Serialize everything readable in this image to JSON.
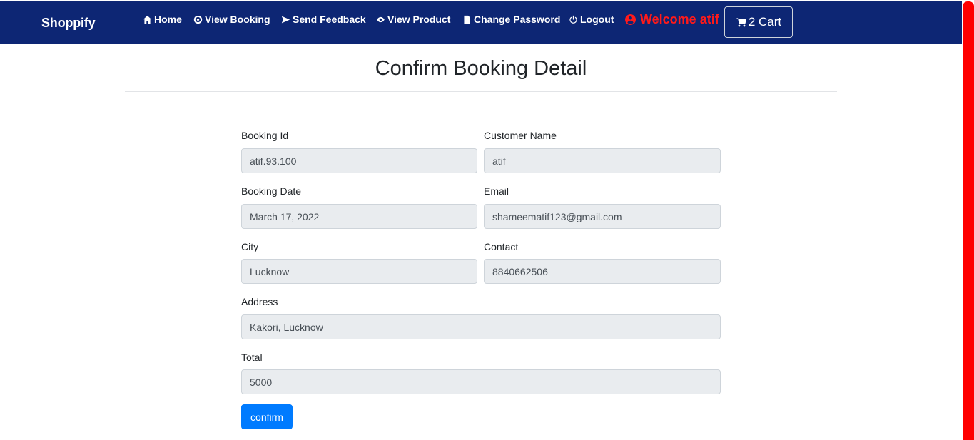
{
  "navbar": {
    "brand": "Shoppify",
    "items": [
      {
        "label": "Home",
        "icon": "home-icon"
      },
      {
        "label": "View Booking",
        "icon": "dashboard-icon"
      },
      {
        "label": "Send Feedback",
        "icon": "send-icon"
      },
      {
        "label": "View Product",
        "icon": "eye-icon"
      },
      {
        "label": "Change Password",
        "icon": "document-icon"
      },
      {
        "label": "Logout",
        "icon": "power-icon"
      }
    ],
    "welcome": "Welcome atif",
    "cart_label": "2 Cart"
  },
  "page": {
    "title": "Confirm Booking Detail"
  },
  "form": {
    "booking_id": {
      "label": "Booking Id",
      "value": "atif.93.100"
    },
    "customer_name": {
      "label": "Customer Name",
      "value": "atif"
    },
    "booking_date": {
      "label": "Booking Date",
      "value": "March 17, 2022"
    },
    "email": {
      "label": "Email",
      "value": "shameematif123@gmail.com"
    },
    "city": {
      "label": "City",
      "value": "Lucknow"
    },
    "contact": {
      "label": "Contact",
      "value": "8840662506"
    },
    "address": {
      "label": "Address",
      "value": "Kakori, Lucknow"
    },
    "total": {
      "label": "Total",
      "value": "5000"
    },
    "confirm_label": "confirm"
  },
  "colors": {
    "navbar_bg": "#0d2674",
    "welcome": "#ff1a1a",
    "primary": "#007bff",
    "scrollbar": "#ff0000"
  }
}
